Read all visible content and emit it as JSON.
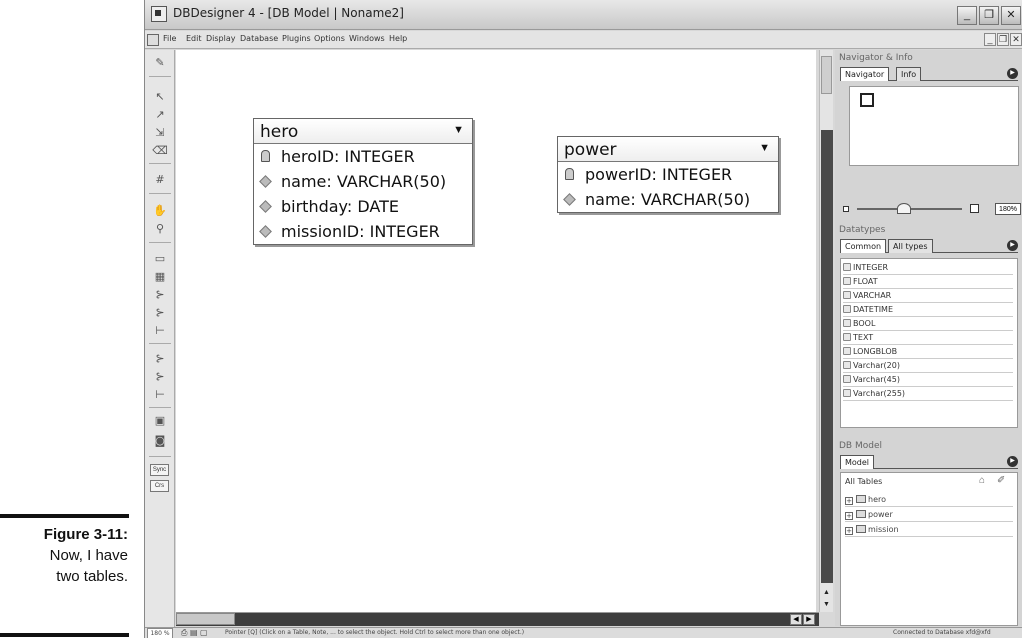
{
  "caption": {
    "label": "Figure 3-11:",
    "lines": [
      "Now, I have",
      "two tables."
    ]
  },
  "window": {
    "title": "DBDesigner 4 - [DB Model | Noname2]",
    "controls": [
      "_",
      "❐",
      "✕"
    ]
  },
  "menu": {
    "items": [
      "File",
      "Edit",
      "Display",
      "Database",
      "Plugins",
      "Options",
      "Windows",
      "Help"
    ],
    "mdi_controls": [
      "_",
      "❐",
      "✕"
    ]
  },
  "toolbar": {
    "tools": [
      "pointer-tool",
      "select-add-tool",
      "move-tool",
      "eraser-tool",
      "grid-tool",
      "hand-tool",
      "zoom-tool",
      "region-tool",
      "table-tool",
      "relation-1n-tool",
      "relation-11-tool",
      "relation-nm-tool",
      "relation-1n-sub-tool",
      "relation-11-sub-tool",
      "relation-nm-sub-tool",
      "note-tool",
      "image-tool"
    ],
    "sync_label": "Sync",
    "crs_label": "Crs"
  },
  "tables": [
    {
      "name": "hero",
      "columns": [
        {
          "icon": "primary-key-icon",
          "text": "heroID: INTEGER"
        },
        {
          "icon": "field-icon",
          "text": "name: VARCHAR(50)"
        },
        {
          "icon": "field-icon",
          "text": "birthday: DATE"
        },
        {
          "icon": "field-icon",
          "text": "missionID: INTEGER"
        }
      ]
    },
    {
      "name": "power",
      "columns": [
        {
          "icon": "primary-key-icon",
          "text": "powerID: INTEGER"
        },
        {
          "icon": "field-icon",
          "text": "name: VARCHAR(50)"
        }
      ]
    }
  ],
  "navigator": {
    "title": "Navigator & Info",
    "tabs": [
      "Navigator",
      "Info"
    ],
    "zoom": "180%"
  },
  "datatypes": {
    "title": "Datatypes",
    "tabs": [
      "Common",
      "All types"
    ],
    "items": [
      "INTEGER",
      "FLOAT",
      "VARCHAR",
      "DATETIME",
      "BOOL",
      "TEXT",
      "LONGBLOB",
      "Varchar(20)",
      "Varchar(45)",
      "Varchar(255)"
    ]
  },
  "dbmodel": {
    "title": "DB Model",
    "tabs": [
      "Model"
    ],
    "heading": "All Tables",
    "tables": [
      "hero",
      "power",
      "mission"
    ]
  },
  "status": {
    "zoom": "180 %",
    "message": "Pointer [Q] (Click on a Table, Note, ... to select the object. Hold Ctrl to select more than one object.)",
    "connection": "Connected to Database xfd@xfd"
  }
}
